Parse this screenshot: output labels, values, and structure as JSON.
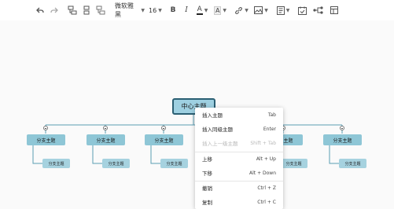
{
  "toolbar": {
    "font_family": "微软雅黑",
    "font_size": "16",
    "bold_label": "B",
    "italic_label": "I",
    "font_color_label": "A",
    "highlight_label": "A",
    "font_color_bar": "#222222",
    "highlight_bar": "#dddddd"
  },
  "mindmap": {
    "root": "中心主题",
    "branches": [
      {
        "label": "分支主题",
        "child": "分支主题"
      },
      {
        "label": "分支主题",
        "child": "分支主题"
      },
      {
        "label": "分支主题",
        "child": "分支主题"
      },
      {
        "label": "分支主题",
        "child": "分支主题"
      },
      {
        "label": "分支主题",
        "child": "分支主题"
      }
    ]
  },
  "context_menu": {
    "items": [
      {
        "label": "插入主题",
        "shortcut": "Tab",
        "disabled": false
      },
      {
        "label": "插入同级主题",
        "shortcut": "Enter",
        "disabled": false
      },
      {
        "label": "插入上一级主题",
        "shortcut": "Shift + Tab",
        "disabled": true
      },
      {
        "label": "上移",
        "shortcut": "Alt + Up",
        "disabled": false
      },
      {
        "label": "下移",
        "shortcut": "Alt + Down",
        "disabled": false
      },
      {
        "label": "撤销",
        "shortcut": "Ctrl + Z",
        "disabled": false
      },
      {
        "label": "复制",
        "shortcut": "Ctrl + C",
        "disabled": false
      }
    ]
  },
  "colors": {
    "root_fill": "#9ed0e1",
    "root_border": "#2b5f73",
    "branch_fill": "#8ec6d6",
    "leaf_fill": "#a6d2df",
    "line": "#5a9db3"
  }
}
